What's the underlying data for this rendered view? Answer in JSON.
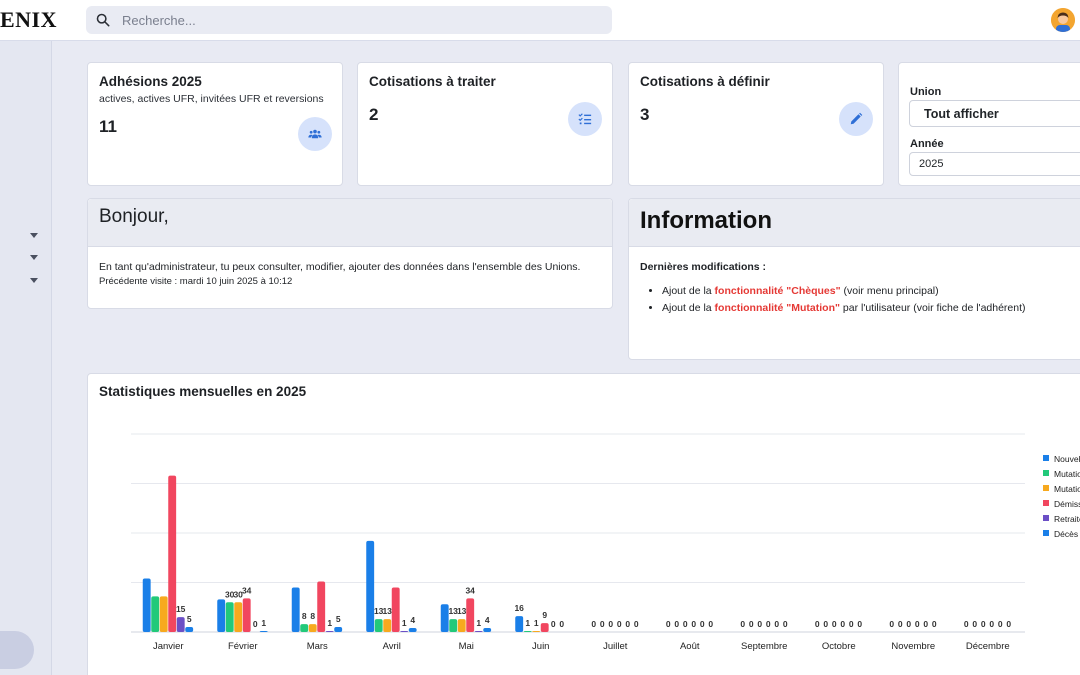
{
  "brand": "ENIX",
  "search": {
    "placeholder": "Recherche..."
  },
  "kpis": [
    {
      "title": "Adhésions 2025",
      "subtitle": "actives, actives UFR, invitées UFR et reversions",
      "value": "11",
      "icon": "users-icon"
    },
    {
      "title": "Cotisations à traiter",
      "subtitle": "",
      "value": "2",
      "icon": "list-check-icon"
    },
    {
      "title": "Cotisations à définir",
      "subtitle": "",
      "value": "3",
      "icon": "pencil-icon"
    }
  ],
  "filters": {
    "union_label": "Union",
    "union_value": "Tout afficher",
    "year_label": "Année",
    "year_value": "2025"
  },
  "welcome": {
    "title": "Bonjour,",
    "text": "En tant qu'administrateur, tu peux consulter, modifier, ajouter des données dans l'ensemble des Unions.",
    "last_visit": "Précédente visite : mardi 10 juin 2025 à 10:12"
  },
  "info": {
    "title": "Information",
    "subtitle": "Dernières modifications :",
    "items": [
      {
        "prefix": "Ajout de la ",
        "highlight": "fonctionnalité \"Chèques\"",
        "suffix": " (voir menu principal)"
      },
      {
        "prefix": "Ajout de la ",
        "highlight": "fonctionnalité \"Mutation\"",
        "suffix": " par l'utilisateur (voir fiche de l'adhérent)"
      }
    ]
  },
  "stats": {
    "title": "Statistiques mensuelles en 2025"
  },
  "colors": {
    "accent": "#d6e2fb",
    "highlight": "#e53935",
    "series": [
      "#1a7fe8",
      "#22c97a",
      "#f7a91e",
      "#f1465f",
      "#6b4fc6",
      "#1a7fe8"
    ]
  },
  "chart_data": {
    "type": "bar",
    "categories": [
      "Janvier",
      "Février",
      "Mars",
      "Avril",
      "Mai",
      "Juin",
      "Juillet",
      "Août",
      "Septembre",
      "Octobre",
      "Novembre",
      "Décembre"
    ],
    "ylim": [
      0,
      200
    ],
    "grid": true,
    "legend_position": "right",
    "series": [
      {
        "name": "Nouvell",
        "values": [
          54,
          33,
          45,
          92,
          28,
          16,
          0,
          0,
          0,
          0,
          0,
          0
        ]
      },
      {
        "name": "Mutatio",
        "values": [
          36,
          30,
          8,
          13,
          13,
          1,
          0,
          0,
          0,
          0,
          0,
          0
        ]
      },
      {
        "name": "Mutatio",
        "values": [
          36,
          30,
          8,
          13,
          13,
          1,
          0,
          0,
          0,
          0,
          0,
          0
        ]
      },
      {
        "name": "Démiss",
        "values": [
          158,
          34,
          51,
          45,
          34,
          9,
          0,
          0,
          0,
          0,
          0,
          0
        ]
      },
      {
        "name": "Retraite",
        "values": [
          15,
          0,
          1,
          1,
          1,
          0,
          0,
          0,
          0,
          0,
          0,
          0
        ]
      },
      {
        "name": "Décès",
        "values": [
          5,
          1,
          5,
          4,
          4,
          0,
          0,
          0,
          0,
          0,
          0,
          0
        ]
      }
    ],
    "value_labels": [
      [
        "",
        "",
        "",
        "",
        "15",
        "5"
      ],
      [
        "",
        "30",
        "30",
        "34",
        "0",
        "1"
      ],
      [
        "",
        "8",
        "8",
        "",
        "1",
        "5"
      ],
      [
        "",
        "13",
        "13",
        "",
        "1",
        "4"
      ],
      [
        "",
        "13",
        "13",
        "34",
        "1",
        "4"
      ],
      [
        "16",
        "1",
        "1",
        "9",
        "0",
        "0"
      ],
      [
        "0",
        "0",
        "0",
        "0",
        "0",
        "0"
      ],
      [
        "0",
        "0",
        "0",
        "0",
        "0",
        "0"
      ],
      [
        "0",
        "0",
        "0",
        "0",
        "0",
        "0"
      ],
      [
        "0",
        "0",
        "0",
        "0",
        "0",
        "0"
      ],
      [
        "0",
        "0",
        "0",
        "0",
        "0",
        "0"
      ],
      [
        "0",
        "0",
        "0",
        "0",
        "0",
        "0"
      ]
    ]
  }
}
